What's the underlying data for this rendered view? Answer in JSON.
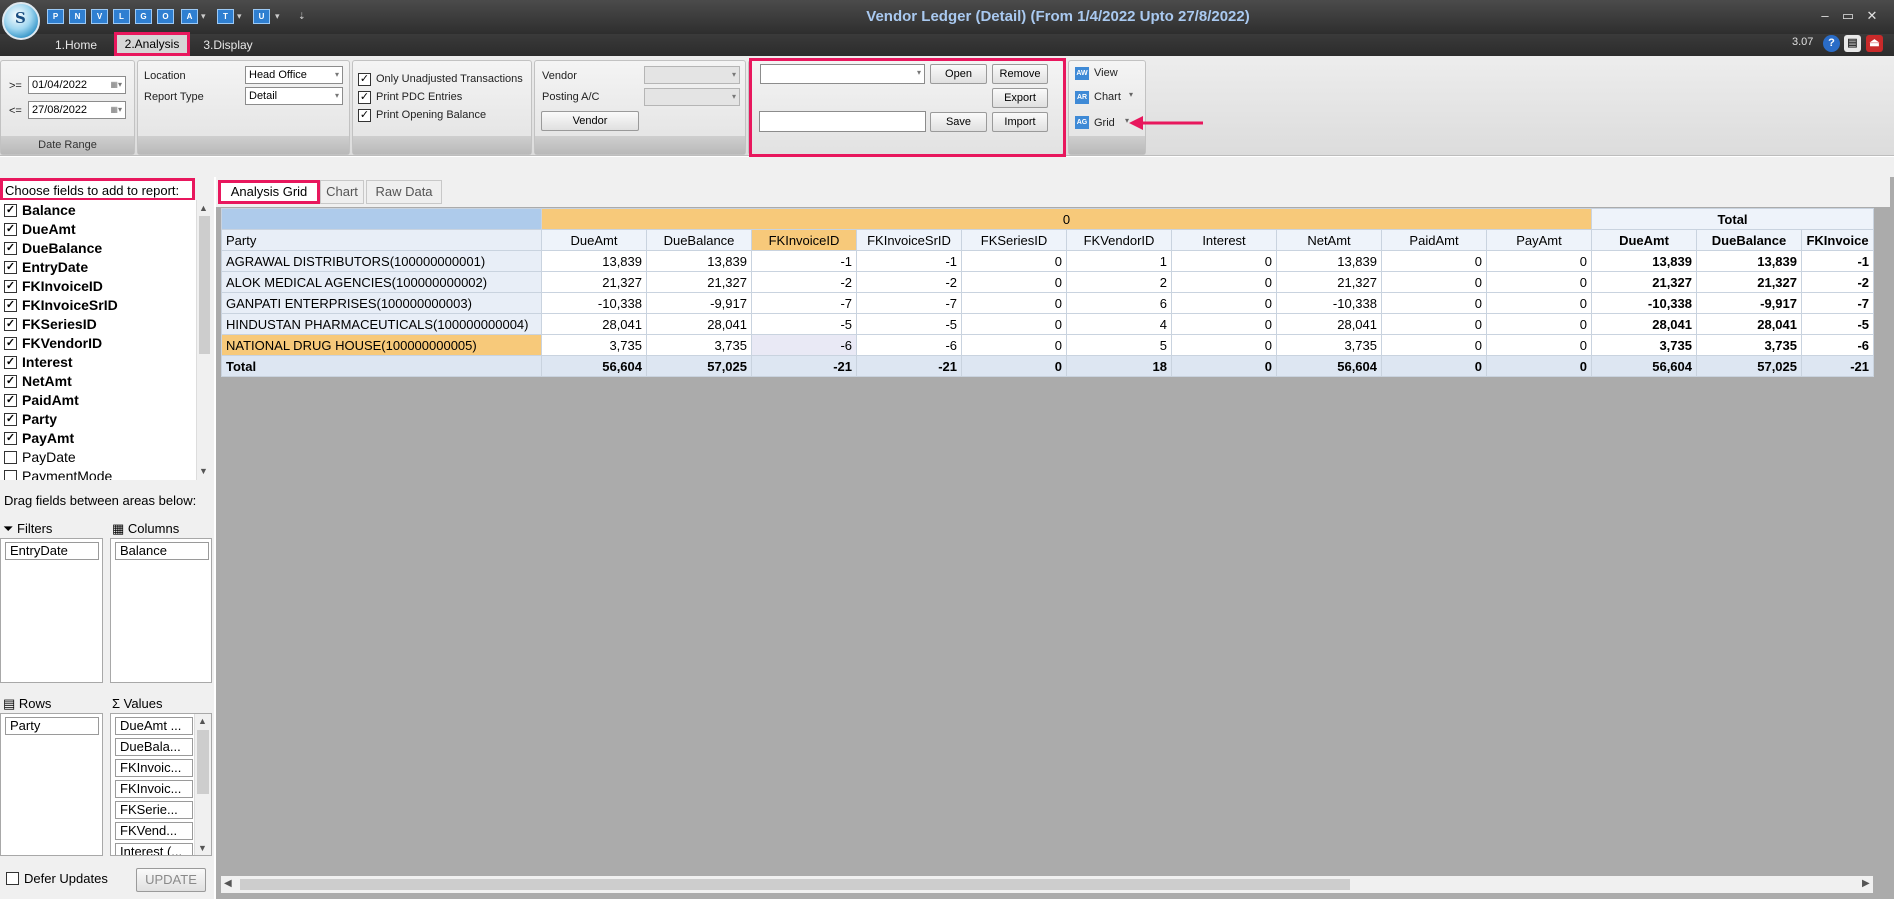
{
  "window": {
    "title": "Vendor Ledger (Detail)  (From 1/4/2022 Upto 27/8/2022)",
    "version": "3.07",
    "quick_access": [
      "P",
      "N",
      "V",
      "L",
      "G",
      "O",
      "A",
      "T",
      "U"
    ]
  },
  "ribbon_tabs": [
    "1.Home",
    "2.Analysis",
    "3.Display"
  ],
  "date_range": {
    "from_op": ">=",
    "from": "01/04/2022",
    "to_op": "<=",
    "to": "27/08/2022",
    "caption": "Date Range"
  },
  "location": {
    "label": "Location",
    "value": "Head Office"
  },
  "report_type": {
    "label": "Report Type",
    "value": "Detail"
  },
  "options": [
    {
      "label": "Only Unadjusted Transactions",
      "checked": true
    },
    {
      "label": "Print PDC Entries",
      "checked": true
    },
    {
      "label": "Print Opening Balance",
      "checked": true
    }
  ],
  "vendor": {
    "label": "Vendor",
    "posting_label": "Posting A/C",
    "button": "Vendor"
  },
  "layout_buttons": {
    "open": "Open",
    "remove": "Remove",
    "export": "Export",
    "save": "Save",
    "import": "Import"
  },
  "view_buttons": {
    "view": "View",
    "chart": "Chart",
    "grid": "Grid"
  },
  "field_list": {
    "title": "Choose fields to add to report:",
    "items": [
      {
        "label": "Balance",
        "checked": true
      },
      {
        "label": "DueAmt",
        "checked": true
      },
      {
        "label": "DueBalance",
        "checked": true
      },
      {
        "label": "EntryDate",
        "checked": true
      },
      {
        "label": "FKInvoiceID",
        "checked": true
      },
      {
        "label": "FKInvoiceSrID",
        "checked": true
      },
      {
        "label": "FKSeriesID",
        "checked": true
      },
      {
        "label": "FKVendorID",
        "checked": true
      },
      {
        "label": "Interest",
        "checked": true
      },
      {
        "label": "NetAmt",
        "checked": true
      },
      {
        "label": "PaidAmt",
        "checked": true
      },
      {
        "label": "Party",
        "checked": true
      },
      {
        "label": "PayAmt",
        "checked": true
      },
      {
        "label": "PayDate",
        "checked": false
      },
      {
        "label": "PaymentMode",
        "checked": false
      }
    ]
  },
  "areas": {
    "drag_hint": "Drag fields between areas below:",
    "filters_label": "Filters",
    "columns_label": "Columns",
    "rows_label": "Rows",
    "values_label": "Values",
    "filters": [
      "EntryDate"
    ],
    "columns": [
      "Balance"
    ],
    "rows": [
      "Party"
    ],
    "values": [
      "DueAmt ...",
      "DueBala...",
      "FKInvoic...",
      "FKInvoic...",
      "FKSerie...",
      "FKVend...",
      "Interest (..."
    ]
  },
  "defer": {
    "label": "Defer Updates",
    "checked": false,
    "button": "UPDATE"
  },
  "grid_tabs": [
    "Analysis Grid",
    "Chart",
    "Raw Data"
  ],
  "grid": {
    "column_group": "0",
    "total_group": "Total",
    "row_header": "Party",
    "columns": [
      "DueAmt",
      "DueBalance",
      "FKInvoiceID",
      "FKInvoiceSrID",
      "FKSeriesID",
      "FKVendorID",
      "Interest",
      "NetAmt",
      "PaidAmt",
      "PayAmt"
    ],
    "total_columns": [
      "DueAmt",
      "DueBalance",
      "FKInvoice"
    ],
    "rows": [
      {
        "party": "AGRAWAL DISTRIBUTORS(100000000001)",
        "values": [
          "13,839",
          "13,839",
          "-1",
          "-1",
          "0",
          "1",
          "0",
          "13,839",
          "0",
          "0"
        ],
        "totals": [
          "13,839",
          "13,839",
          "-1"
        ]
      },
      {
        "party": "ALOK MEDICAL AGENCIES(100000000002)",
        "values": [
          "21,327",
          "21,327",
          "-2",
          "-2",
          "0",
          "2",
          "0",
          "21,327",
          "0",
          "0"
        ],
        "totals": [
          "21,327",
          "21,327",
          "-2"
        ]
      },
      {
        "party": "GANPATI ENTERPRISES(100000000003)",
        "values": [
          "-10,338",
          "-9,917",
          "-7",
          "-7",
          "0",
          "6",
          "0",
          "-10,338",
          "0",
          "0"
        ],
        "totals": [
          "-10,338",
          "-9,917",
          "-7"
        ]
      },
      {
        "party": "HINDUSTAN PHARMACEUTICALS(100000000004)",
        "values": [
          "28,041",
          "28,041",
          "-5",
          "-5",
          "0",
          "4",
          "0",
          "28,041",
          "0",
          "0"
        ],
        "totals": [
          "28,041",
          "28,041",
          "-5"
        ]
      },
      {
        "party": "NATIONAL DRUG HOUSE(100000000005)",
        "values": [
          "3,735",
          "3,735",
          "-6",
          "-6",
          "0",
          "5",
          "0",
          "3,735",
          "0",
          "0"
        ],
        "totals": [
          "3,735",
          "3,735",
          "-6"
        ]
      }
    ],
    "total_row": {
      "label": "Total",
      "values": [
        "56,604",
        "57,025",
        "-21",
        "-21",
        "0",
        "18",
        "0",
        "56,604",
        "0",
        "0"
      ],
      "totals": [
        "56,604",
        "57,025",
        "-21"
      ]
    }
  },
  "colors": {
    "highlight": "#e8175d",
    "selection": "#f7c97a",
    "grid_header_group": "#f7c97a"
  }
}
